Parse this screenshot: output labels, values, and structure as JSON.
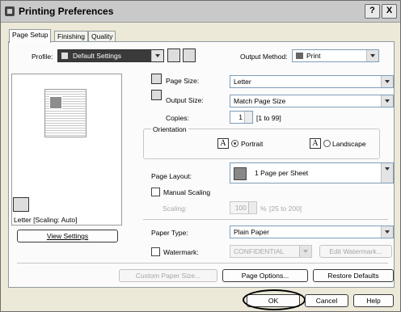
{
  "window": {
    "title": "Printing Preferences",
    "help_glyph": "?",
    "close_glyph": "X"
  },
  "tabs": [
    "Page Setup",
    "Finishing",
    "Quality"
  ],
  "profile": {
    "label": "Profile:",
    "value": "Default Settings"
  },
  "output_method": {
    "label": "Output Method:",
    "value": "Print"
  },
  "preview": {
    "status_text": "Letter [Scaling: Auto]",
    "view_settings_label": "View Settings"
  },
  "page_size": {
    "label": "Page Size:",
    "value": "Letter"
  },
  "output_size": {
    "label": "Output Size:",
    "value": "Match Page Size"
  },
  "copies": {
    "label": "Copies:",
    "value": "1",
    "range": "[1 to 99]"
  },
  "orientation": {
    "group_label": "Orientation",
    "portrait_label": "Portrait",
    "landscape_label": "Landscape",
    "selected": "Portrait",
    "glyph": "A"
  },
  "page_layout": {
    "label": "Page Layout:",
    "value": "1 Page per Sheet"
  },
  "manual_scaling": {
    "label": "Manual Scaling",
    "checked": false
  },
  "scaling": {
    "label": "Scaling:",
    "value": "100",
    "unit": "%",
    "range": "[25 to 200]"
  },
  "paper_type": {
    "label": "Paper Type:",
    "value": "Plain Paper"
  },
  "watermark": {
    "label": "Watermark:",
    "checked": false,
    "value": "CONFIDENTIAL",
    "edit_label": "Edit Watermark..."
  },
  "buttons": {
    "custom_paper_size": "Custom Paper Size...",
    "page_options": "Page Options...",
    "restore_defaults": "Restore Defaults",
    "ok": "OK",
    "cancel": "Cancel",
    "help": "Help"
  }
}
